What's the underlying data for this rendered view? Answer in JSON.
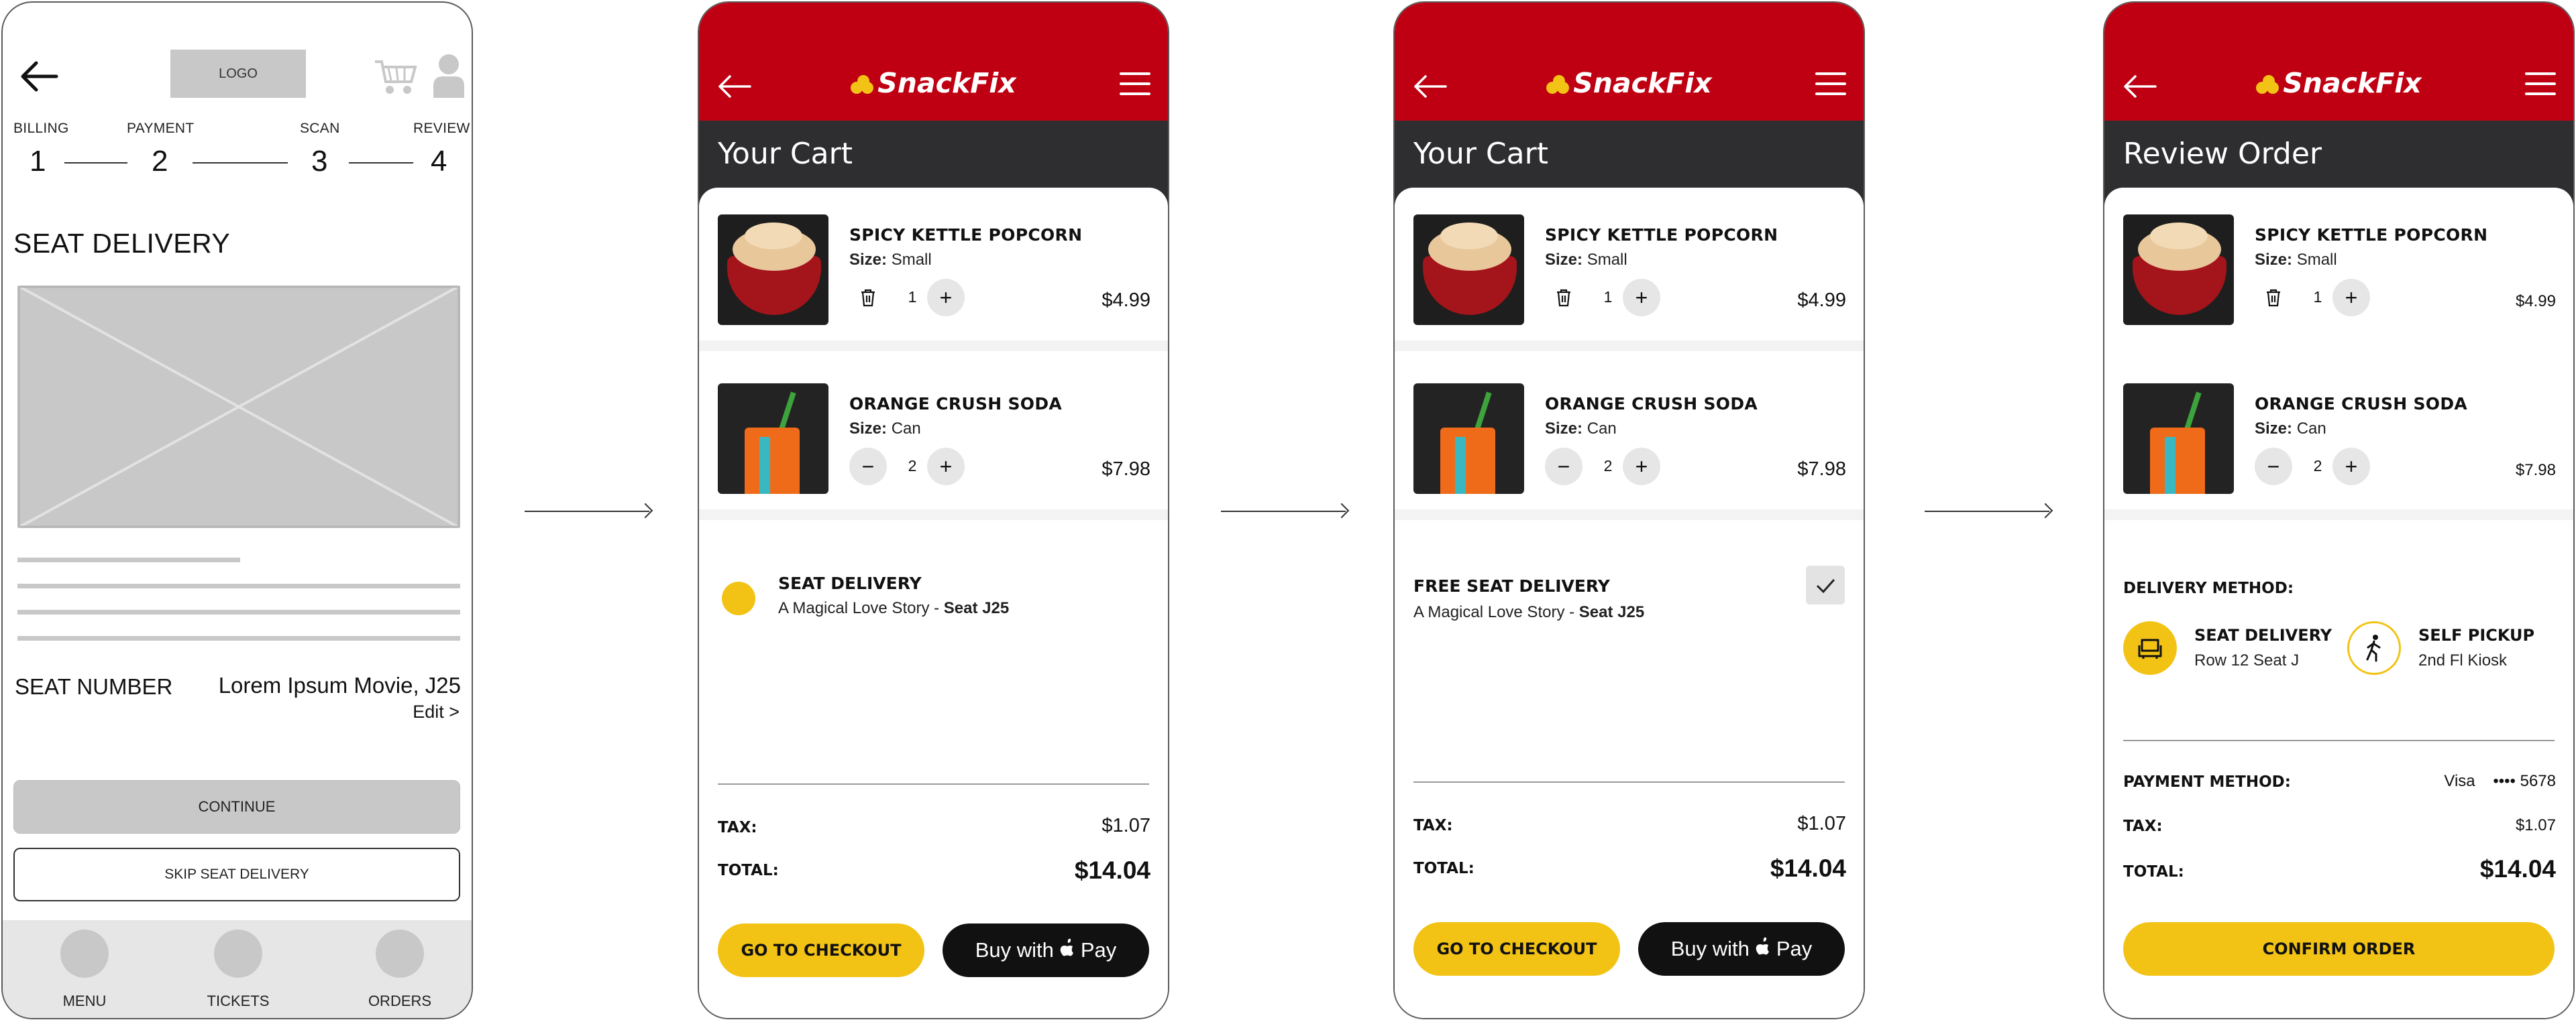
{
  "wireframe": {
    "logo": "LOGO",
    "steps": [
      {
        "label": "BILLING",
        "num": "1"
      },
      {
        "label": "PAYMENT",
        "num": "2"
      },
      {
        "label": "SCAN",
        "num": "3"
      },
      {
        "label": "REVIEW",
        "num": "4"
      }
    ],
    "title": "SEAT DELIVERY",
    "seat_label": "SEAT NUMBER",
    "seat_value": "Lorem Ipsum Movie, J25",
    "edit": "Edit >",
    "continue": "CONTINUE",
    "skip": "SKIP SEAT DELIVERY",
    "tabs": [
      "MENU",
      "TICKETS",
      "ORDERS"
    ]
  },
  "brand": {
    "name": "SnackFix",
    "colors": {
      "header": "#bf0012",
      "titlebar": "#2e2e31",
      "accent": "#f2c315"
    }
  },
  "items": [
    {
      "name": "SPICY KETTLE POPCORN",
      "size_label": "Size:",
      "size": "Small",
      "qty": "1",
      "price": "$4.99"
    },
    {
      "name": "ORANGE CRUSH SODA",
      "size_label": "Size:",
      "size": "Can",
      "qty": "2",
      "price": "$7.98"
    }
  ],
  "cart": {
    "title": "Your Cart",
    "delivery_title": "SEAT DELIVERY",
    "free_delivery_title": "FREE SEAT DELIVERY",
    "delivery_movie": "A Magical Love Story - ",
    "delivery_seat": "Seat J25",
    "tax_label": "TAX:",
    "tax": "$1.07",
    "total_label": "TOTAL:",
    "total": "$14.04",
    "checkout": "GO TO CHECKOUT",
    "apay_prefix": "Buy with",
    "apay_suffix": "Pay"
  },
  "review": {
    "title": "Review Order",
    "delivery_method_label": "DELIVERY METHOD:",
    "methods": [
      {
        "title": "SEAT DELIVERY",
        "sub": "Row 12 Seat J",
        "icon": "seat-icon"
      },
      {
        "title": "SELF PICKUP",
        "sub": "2nd Fl Kiosk",
        "icon": "walking-person-icon"
      }
    ],
    "payment_label": "PAYMENT METHOD:",
    "payment_card": "Visa",
    "payment_digits": "•••• 5678",
    "tax_label": "TAX:",
    "tax": "$1.07",
    "total_label": "TOTAL:",
    "total": "$14.04",
    "confirm": "CONFIRM ORDER"
  }
}
